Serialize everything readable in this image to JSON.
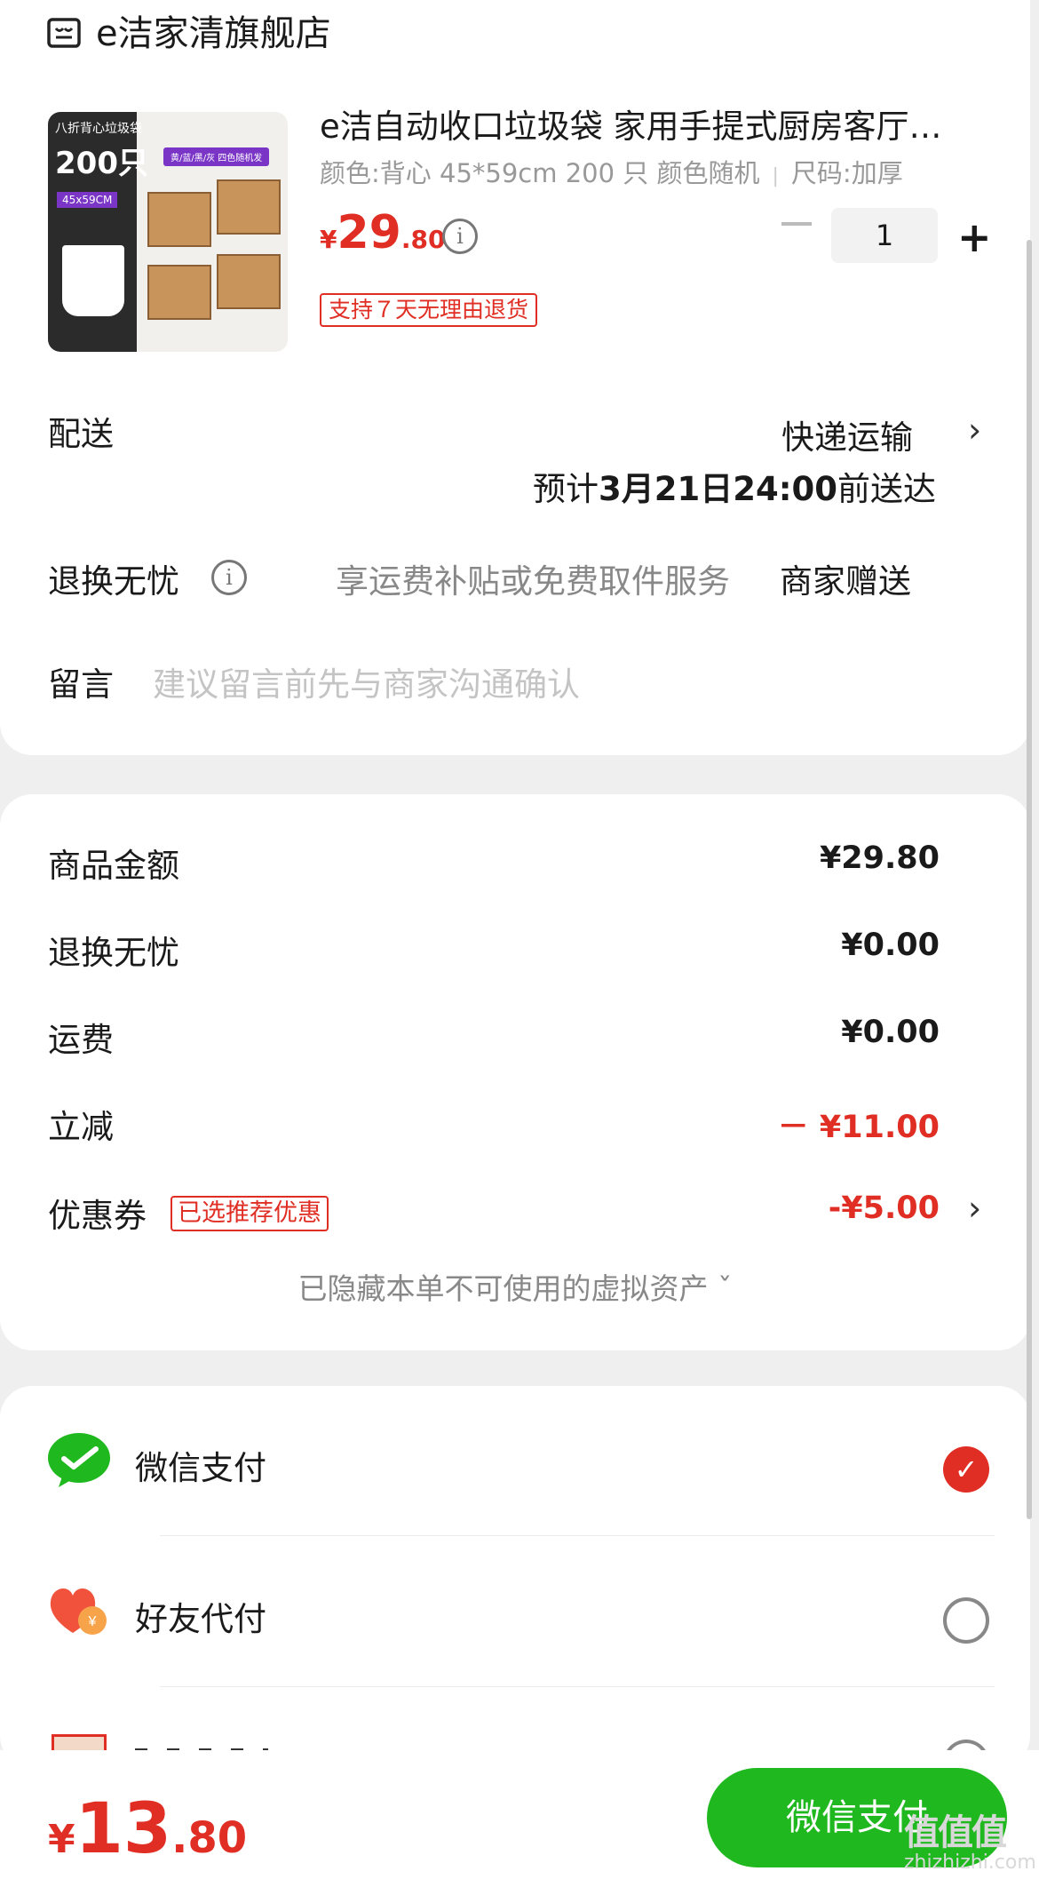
{
  "store": {
    "name": "e洁家清旗舰店",
    "icon": "store-icon"
  },
  "product": {
    "title": "e洁自动收口垃圾袋 家用手提式厨房客厅…",
    "color_spec": "颜色:背心 45*59cm 200 只 颜色随机",
    "size_spec": "尺码:加厚",
    "price_currency": "¥",
    "price_int": "29",
    "price_dec": ".80",
    "quantity": "1",
    "return_tag": "支持７天无理由退货",
    "thumb": {
      "top_label": "八折背心垃圾袋",
      "count": "200只",
      "size": "45x59CM",
      "banner": "黄/蓝/黑/灰 四色随机发"
    }
  },
  "delivery": {
    "label": "配送",
    "method": "快递运输",
    "eta_prefix": "预计",
    "eta_date": "3月21日24:00",
    "eta_suffix": "前送达"
  },
  "return_service": {
    "label": "退换无忧",
    "desc": "享运费补贴或免费取件服务",
    "gift": "商家赠送"
  },
  "message": {
    "label": "留言",
    "placeholder": "建议留言前先与商家沟通确认"
  },
  "summary": {
    "goods": {
      "label": "商品金额",
      "value": "¥29.80"
    },
    "return": {
      "label": "退换无忧",
      "value": "¥0.00"
    },
    "shipping": {
      "label": "运费",
      "value": "¥0.00"
    },
    "discount": {
      "label": "立减",
      "value": "－ ¥11.00"
    },
    "coupon": {
      "label": "优惠券",
      "tag": "已选推荐优惠",
      "value": "-¥5.00"
    },
    "hidden_assets": "已隐藏本单不可使用的虚拟资产 ˇ"
  },
  "payment_methods": [
    {
      "label": "微信支付",
      "icon": "wechat-pay-icon",
      "selected": true
    },
    {
      "label": "好友代付",
      "icon": "friend-pay-heart-icon",
      "selected": false
    }
  ],
  "bottom": {
    "currency": "¥",
    "total_int": "13",
    "total_dec": ".80",
    "pay_button": "微信支付"
  },
  "watermark": {
    "text": "值值值",
    "site": "zhizhizhi.com"
  },
  "colors": {
    "accent_red": "#e02e24",
    "wechat_green": "#1fb91f"
  }
}
